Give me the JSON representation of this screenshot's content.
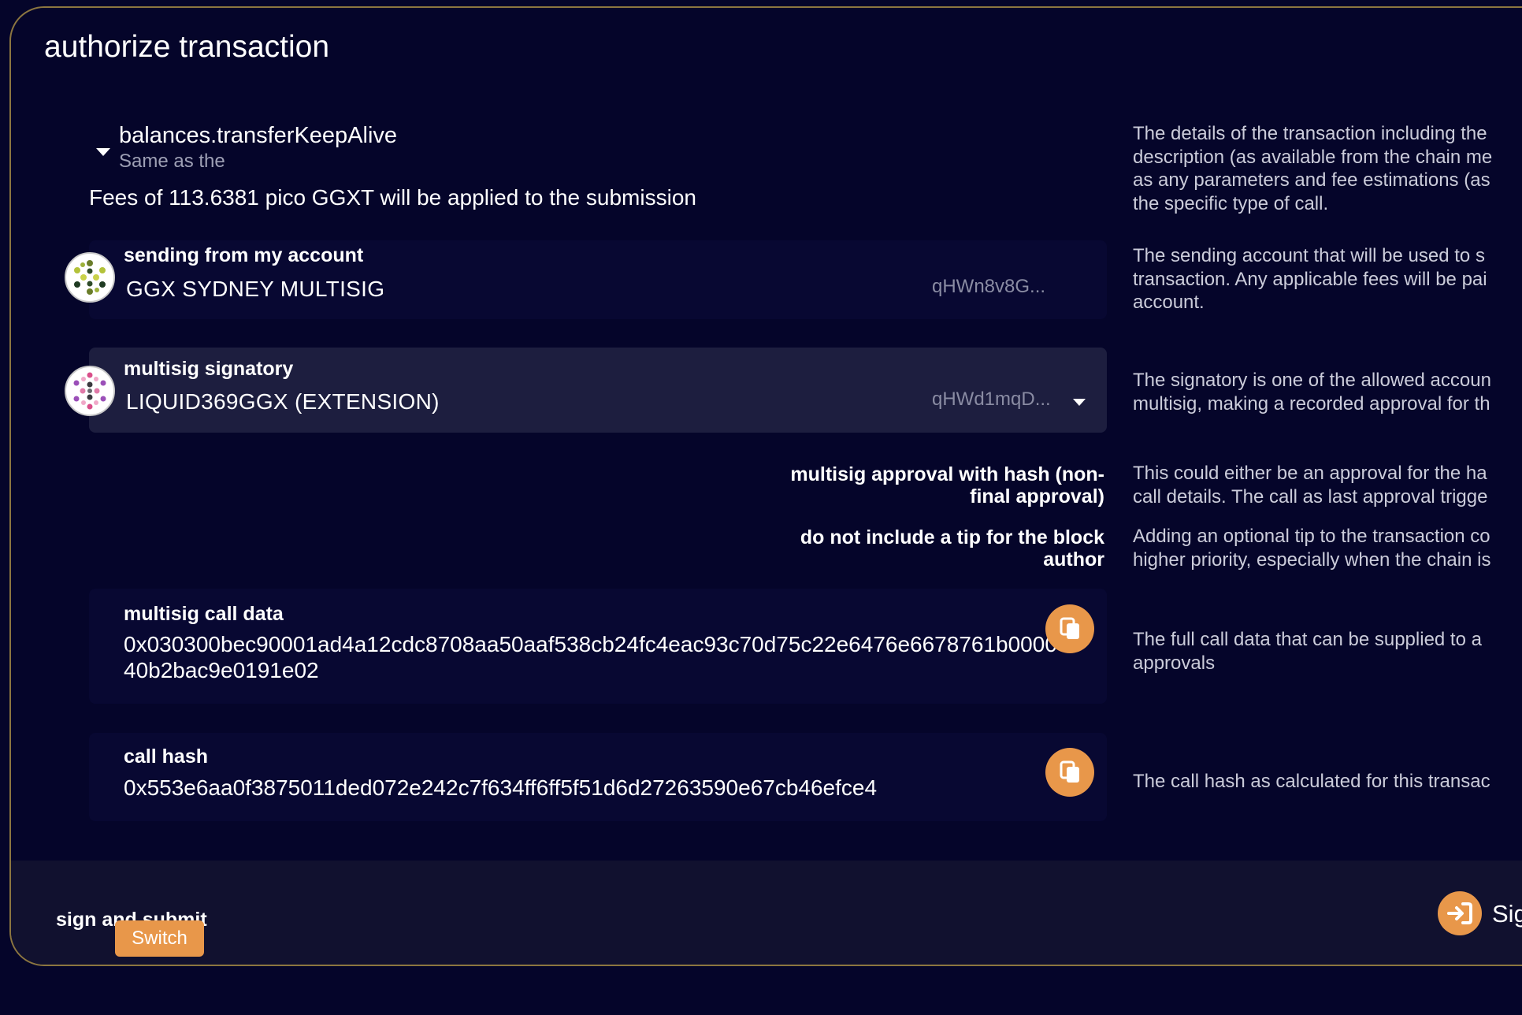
{
  "modal": {
    "title": "authorize transaction"
  },
  "call": {
    "name": "balances.transferKeepAlive",
    "doc": "Same as the",
    "fees": "Fees of 113.6381 pico GGXT will be applied to the submission",
    "help": [
      "The details of the transaction including the",
      "description (as available from the chain me",
      "as any parameters and fee estimations (as",
      "the specific type of call."
    ]
  },
  "sender": {
    "label": "sending from my account",
    "name": "GGX SYDNEY MULTISIG",
    "address": "qHWn8v8G...",
    "help": [
      "The sending account that will be used to s",
      "transaction. Any applicable fees will be pai",
      "account."
    ]
  },
  "signatory": {
    "label": "multisig signatory",
    "name": "LIQUID369GGX (EXTENSION)",
    "address": "qHWd1mqD...",
    "help": [
      "The signatory is one of the allowed accoun",
      "multisig, making a recorded approval for th"
    ]
  },
  "approval_toggle": {
    "line1": "multisig approval with hash (non-",
    "line2": "final approval)",
    "help": [
      "This could either be an approval for the ha",
      "call details. The call as last approval trigge"
    ]
  },
  "tip_toggle": {
    "line1": "do not include a tip for the block",
    "line2": "author",
    "help": [
      "Adding an optional tip to the transaction co",
      "higher priority, especially when the chain is"
    ]
  },
  "call_data": {
    "label": "multisig call data",
    "value": "0x030300bec90001ad4a12cdc8708aa50aaf538cb24fc4eac93c70d75c22e6476e6678761b000040b2bac9e0191e02",
    "help": [
      "The full call data that can be supplied to a",
      "approvals"
    ]
  },
  "call_hash": {
    "label": "call hash",
    "value": "0x553e6aa0f3875011ded072e242c7f634ff6ff5f51d6d27263590e67cb46efce4",
    "help": [
      "The call hash as calculated for this transac"
    ]
  },
  "footer": {
    "sign_label": "sign and submit",
    "switch_label": "Switch",
    "sign_button": "Sign"
  },
  "colors": {
    "background": "#05052a",
    "accent": "#e8974a",
    "border": "#8c7640",
    "muted_text": "#cbccda"
  },
  "icons": {
    "expand": "caret-down-icon",
    "copy": "copy-icon",
    "sign": "sign-in-icon",
    "dropdown": "chevron-down-icon"
  }
}
